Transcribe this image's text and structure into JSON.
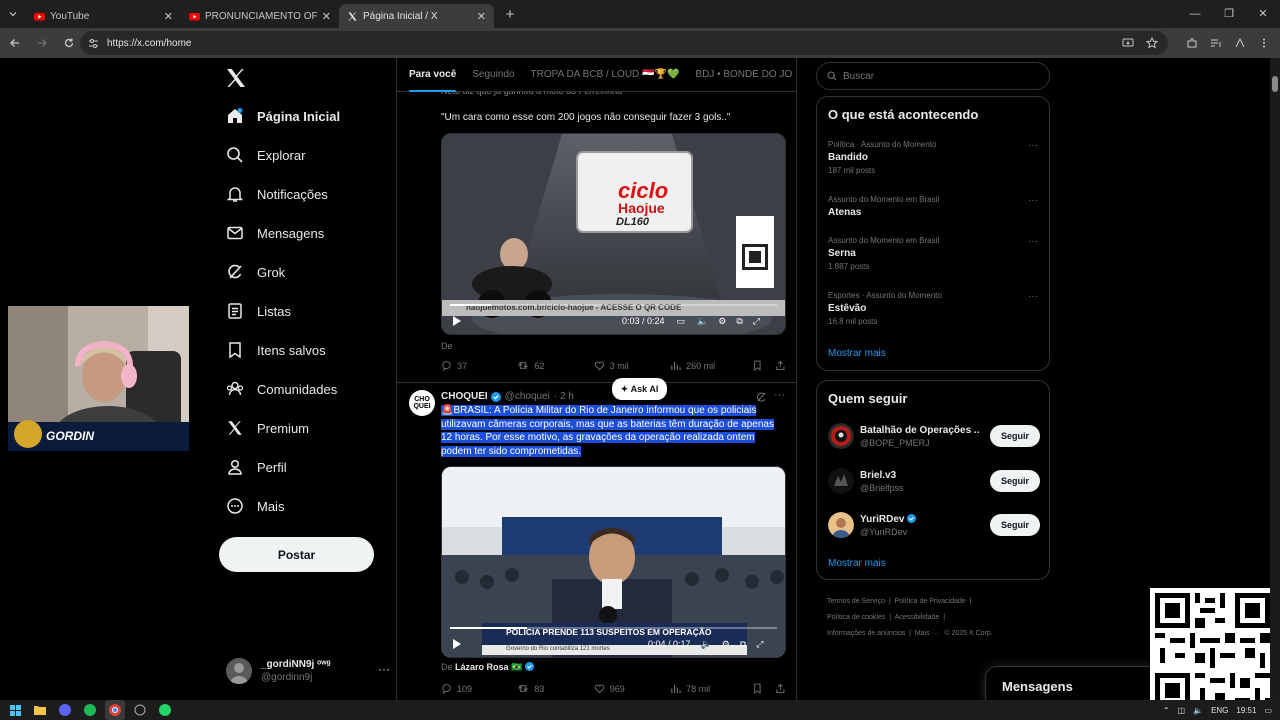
{
  "browser": {
    "tabs": [
      {
        "title": "YouTube",
        "active": false
      },
      {
        "title": "PRONUNCIAMENTO OFICIAL: S",
        "active": false
      },
      {
        "title": "Página Inicial / X",
        "active": true
      }
    ],
    "url": "https://x.com/home"
  },
  "sidebar": {
    "items": [
      {
        "label": "Página Inicial",
        "icon": "home-icon"
      },
      {
        "label": "Explorar",
        "icon": "search-icon"
      },
      {
        "label": "Notificações",
        "icon": "bell-icon"
      },
      {
        "label": "Mensagens",
        "icon": "mail-icon"
      },
      {
        "label": "Grok",
        "icon": "grok-icon"
      },
      {
        "label": "Listas",
        "icon": "list-icon"
      },
      {
        "label": "Itens salvos",
        "icon": "bookmark-icon"
      },
      {
        "label": "Comunidades",
        "icon": "communities-icon"
      },
      {
        "label": "Premium",
        "icon": "x-icon"
      },
      {
        "label": "Perfil",
        "icon": "person-icon"
      },
      {
        "label": "Mais",
        "icon": "more-circle-icon"
      }
    ],
    "post_label": "Postar",
    "account": {
      "name": "_gordiNN9j ᵒʷᵍ",
      "handle": "@gordinn9j"
    }
  },
  "webcam": {
    "overlay_text": "GORDIN"
  },
  "feed": {
    "tabs": [
      "Para você",
      "Seguindo",
      "TROPA DA BCB / LOUD 🇪🇬🏆💚",
      "BDJ • BONDE DO JO"
    ],
    "tweet1": {
      "overcut_text": "Neto diz que já ganhou a moto do Ferreirinha",
      "quote": "\"Um cara como esse com 200 jogos não conseguir fazer 3 gols..\"",
      "video": {
        "brand_top": "ciclo",
        "brand_mid": "Haojue",
        "brand_model": "DL160",
        "banner": "haojuemotos.com.br/ciclo-haojue - ACESSE O QR CODE",
        "time": "0:03 / 0:24",
        "progress": 0.125
      },
      "by": "De",
      "stats": {
        "replies": "37",
        "reposts": "62",
        "likes": "3 mil",
        "views": "260 mil"
      }
    },
    "ask_ai": "Ask AI",
    "tweet2": {
      "author": "CHOQUEI",
      "handle": "@choquei",
      "time": "· 2 h",
      "avatar_text": "CHO QUEI",
      "text_pre": "🚨BRASIL:",
      "text_body": " A Polícia Militar do Rio de Janeiro informou que os policiais utilizavam câmeras corporais, mas que as baterias têm duração de apenas 12 horas. Por esse motivo, as gravações da operação realizada ontem podem ter sido comprometidas.",
      "video": {
        "headline": "POLÍCIA PRENDE 113 SUSPEITOS EM OPERAÇÃO",
        "subline": "Governo do Rio contabiliza 121 mortes",
        "time": "0:04 / 0:17",
        "progress": 0.235
      },
      "by_prefix": "De",
      "by_name": "Lázaro Rosa 🇧🇷",
      "stats": {
        "replies": "109",
        "reposts": "83",
        "likes": "969",
        "views": "78 mil"
      }
    }
  },
  "right": {
    "search_placeholder": "Buscar",
    "trends_title": "O que está acontecendo",
    "trends": [
      {
        "context": "Política · Assunto do Momento",
        "topic": "Bandido",
        "count": "187 mil posts"
      },
      {
        "context": "Assunto do Momento em Brasil",
        "topic": "Atenas",
        "count": ""
      },
      {
        "context": "Assunto do Momento em Brasil",
        "topic": "Serna",
        "count": "1.887 posts"
      },
      {
        "context": "Esportes · Assunto do Momento",
        "topic": "Estêvão",
        "count": "16,8 mil posts"
      }
    ],
    "show_more": "Mostrar mais",
    "who_title": "Quem seguir",
    "who": [
      {
        "name": "Batalhão de Operações ...",
        "handle": "@BOPE_PMERJ",
        "follow": "Seguir"
      },
      {
        "name": "Briel.v3",
        "handle": "@Brielfpss",
        "follow": "Seguir"
      },
      {
        "name": "YuriRDev",
        "handle": "@YuriRDev",
        "follow": "Seguir"
      }
    ],
    "footer": [
      "Termos de Serviço",
      "Política de Privacidade",
      "Política de cookies",
      "Acessibilidade",
      "Informações de anúncios",
      "Mais ···",
      "© 2025 X Corp."
    ]
  },
  "messages_drawer": "Mensagens",
  "taskbar": {
    "lang": "ENG",
    "clock": "19:51"
  },
  "colors": {
    "accent": "#1d9bf0",
    "bg": "#000000",
    "border": "#2f3336",
    "highlight": "#1d4ed8"
  }
}
